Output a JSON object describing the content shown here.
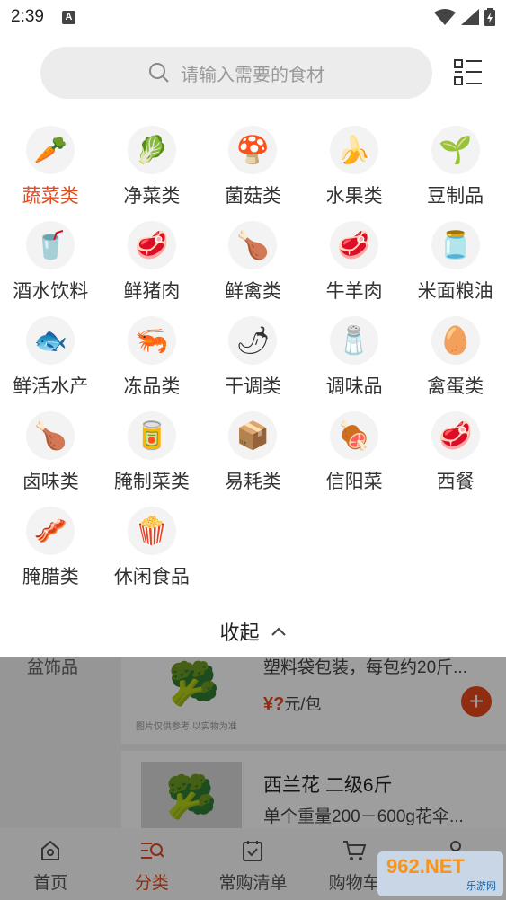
{
  "status": {
    "time": "2:39",
    "a_badge": "A"
  },
  "search": {
    "placeholder": "请输入需要的食材"
  },
  "categories": [
    {
      "label": "蔬菜类",
      "icon": "vegetable-icon",
      "glyph": "🥕",
      "active": true
    },
    {
      "label": "净菜类",
      "icon": "cabbage-icon",
      "glyph": "🥬"
    },
    {
      "label": "菌菇类",
      "icon": "mushroom-icon",
      "glyph": "🍄"
    },
    {
      "label": "水果类",
      "icon": "fruit-icon",
      "glyph": "🍌"
    },
    {
      "label": "豆制品",
      "icon": "bean-sprout-icon",
      "glyph": "🌱"
    },
    {
      "label": "酒水饮料",
      "icon": "cola-icon",
      "glyph": "🥤"
    },
    {
      "label": "鲜猪肉",
      "icon": "pork-icon",
      "glyph": "🥩"
    },
    {
      "label": "鲜禽类",
      "icon": "chicken-icon",
      "glyph": "🍗"
    },
    {
      "label": "牛羊肉",
      "icon": "beef-icon",
      "glyph": "🥩"
    },
    {
      "label": "米面粮油",
      "icon": "oil-icon",
      "glyph": "🫙"
    },
    {
      "label": "鲜活水产",
      "icon": "fish-icon",
      "glyph": "🐟"
    },
    {
      "label": "冻品类",
      "icon": "shrimp-icon",
      "glyph": "🦐"
    },
    {
      "label": "干调类",
      "icon": "chili-icon",
      "glyph": "🌶"
    },
    {
      "label": "调味品",
      "icon": "seasoning-icon",
      "glyph": "🧂"
    },
    {
      "label": "禽蛋类",
      "icon": "egg-icon",
      "glyph": "🥚"
    },
    {
      "label": "卤味类",
      "icon": "braised-meat-icon",
      "glyph": "🍗"
    },
    {
      "label": "腌制菜类",
      "icon": "pickle-icon",
      "glyph": "🥫"
    },
    {
      "label": "易耗类",
      "icon": "consumables-icon",
      "glyph": "📦"
    },
    {
      "label": "信阳菜",
      "icon": "xinyang-dish-icon",
      "glyph": "🍖"
    },
    {
      "label": "西餐",
      "icon": "steak-icon",
      "glyph": "🥩"
    },
    {
      "label": "腌腊类",
      "icon": "cured-meat-icon",
      "glyph": "🥓"
    },
    {
      "label": "休闲食品",
      "icon": "snack-icon",
      "glyph": "🍿"
    }
  ],
  "collapse": {
    "label": "收起"
  },
  "background": {
    "side_label": "盆饰品",
    "card1": {
      "subtitle": "塑料袋包装，每包约20斤...",
      "price_symbol": "¥?",
      "price_unit": "元/包",
      "note": "图片仅供参考,以实物为准"
    },
    "card2": {
      "title": "西兰花 二级6斤",
      "subtitle": "单个重量200－600g花伞..."
    }
  },
  "tabs": [
    {
      "label": "首页",
      "icon": "home-icon"
    },
    {
      "label": "分类",
      "icon": "category-icon",
      "active": true
    },
    {
      "label": "常购清单",
      "icon": "list-check-icon"
    },
    {
      "label": "购物车",
      "icon": "cart-icon"
    },
    {
      "label": "我的",
      "icon": "user-icon"
    }
  ],
  "watermark": {
    "line1": "962.NET",
    "line2": "乐游网"
  },
  "colors": {
    "accent": "#e84a1c",
    "search_bg": "#ececec"
  }
}
